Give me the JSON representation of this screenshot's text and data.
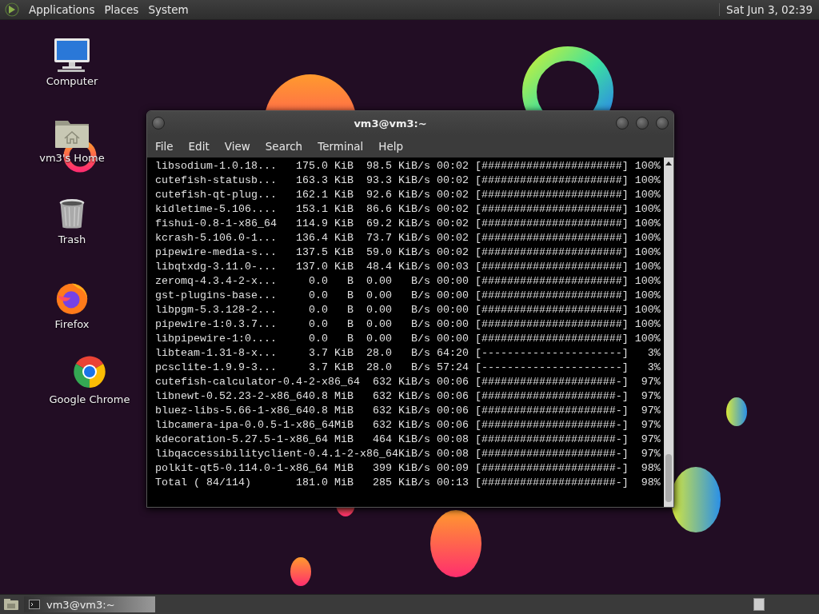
{
  "top_panel": {
    "menus": [
      "Applications",
      "Places",
      "System"
    ],
    "clock": "Sat Jun 3, 02:39"
  },
  "desktop_icons": [
    {
      "label": "Computer",
      "kind": "computer"
    },
    {
      "label": "vm3's Home",
      "kind": "home"
    },
    {
      "label": "Trash",
      "kind": "trash"
    },
    {
      "label": "Firefox",
      "kind": "firefox"
    },
    {
      "label": "Google Chrome",
      "kind": "chrome"
    }
  ],
  "terminal": {
    "title": "vm3@vm3:~",
    "menu": [
      "File",
      "Edit",
      "View",
      "Search",
      "Terminal",
      "Help"
    ],
    "lines": [
      "libsodium-1.0.18...   175.0 KiB  98.5 KiB/s 00:02 [######################] 100%",
      "cutefish-statusb...   163.3 KiB  93.3 KiB/s 00:02 [######################] 100%",
      "cutefish-qt-plug...   162.1 KiB  92.6 KiB/s 00:02 [######################] 100%",
      "kidletime-5.106....   153.1 KiB  86.6 KiB/s 00:02 [######################] 100%",
      "fishui-0.8-1-x86_64   114.9 KiB  69.2 KiB/s 00:02 [######################] 100%",
      "kcrash-5.106.0-1...   136.4 KiB  73.7 KiB/s 00:02 [######################] 100%",
      "pipewire-media-s...   137.5 KiB  59.0 KiB/s 00:02 [######################] 100%",
      "libqtxdg-3.11.0-...   137.0 KiB  48.4 KiB/s 00:03 [######################] 100%",
      "zeromq-4.3.4-2-x...     0.0   B  0.00   B/s 00:00 [######################] 100%",
      "gst-plugins-base...     0.0   B  0.00   B/s 00:00 [######################] 100%",
      "libpgm-5.3.128-2...     0.0   B  0.00   B/s 00:00 [######################] 100%",
      "pipewire-1:0.3.7...     0.0   B  0.00   B/s 00:00 [######################] 100%",
      "libpipewire-1:0....     0.0   B  0.00   B/s 00:00 [######################] 100%",
      "libteam-1.31-8-x...     3.7 KiB  28.0   B/s 64:20 [----------------------]   3%",
      "pcsclite-1.9.9-3...     3.7 KiB  28.0   B/s 57:24 [----------------------]   3%",
      "cutefish-calculator-0.4-2-x86_64  632 KiB/s 00:06 [#####################-]  97%",
      "libnewt-0.52.23-2-x86_640.8 MiB   632 KiB/s 00:06 [#####################-]  97%",
      "bluez-libs-5.66-1-x86_640.8 MiB   632 KiB/s 00:06 [#####################-]  97%",
      "libcamera-ipa-0.0.5-1-x86_64MiB   632 KiB/s 00:06 [#####################-]  97%",
      "kdecoration-5.27.5-1-x86_64 MiB   464 KiB/s 00:08 [#####################-]  97%",
      "libqaccessibilityclient-0.4.1-2-x86_64KiB/s 00:08 [#####################-]  97%",
      "polkit-qt5-0.114.0-1-x86_64 MiB   399 KiB/s 00:09 [#####################-]  98%",
      "Total ( 84/114)       181.0 MiB   285 KiB/s 00:13 [#####################-]  98%"
    ]
  },
  "taskbar": {
    "tasks": [
      {
        "label": "vm3@vm3:~",
        "selected": true
      }
    ]
  }
}
